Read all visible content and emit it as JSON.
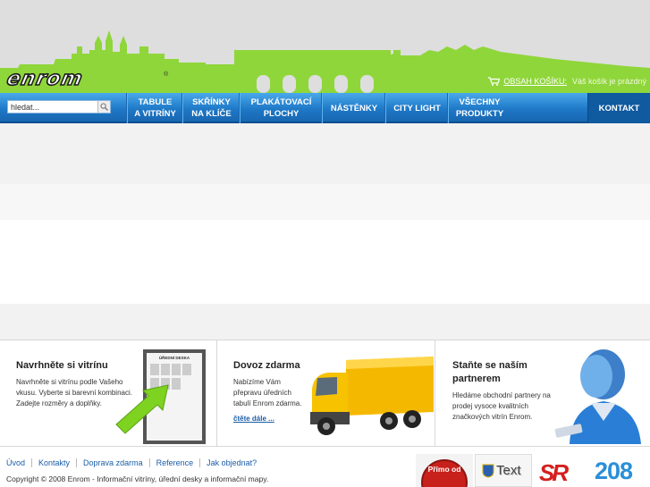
{
  "brand": {
    "logo_text": "enrom",
    "registered": "®"
  },
  "cart": {
    "link_label": "OBSAH KOŠÍKU:",
    "status": "Váš košík je prázdný"
  },
  "search": {
    "placeholder": "hledat..."
  },
  "nav": {
    "items": [
      {
        "line1": "TABULE",
        "line2": "A VITRÍNY"
      },
      {
        "line1": "SKŘÍNKY",
        "line2": "NA KLÍČE"
      },
      {
        "line1": "PLAKÁTOVACÍ",
        "line2": "PLOCHY"
      },
      {
        "line1": "NÁSTĚNKY",
        "line2": ""
      },
      {
        "line1": "CITY LIGHT",
        "line2": ""
      },
      {
        "line1": "VŠECHNY",
        "line2": "PRODUKTY"
      }
    ],
    "contact": "KONTAKT"
  },
  "features": [
    {
      "title": "Navrhněte si vitrínu",
      "text": "Navrhněte si vitrínu podle Vašeho vkusu. Vyberte si barevní kombinaci. Zadejte rozměry a doplňky.",
      "board_title": "ÚŘEDNÍ DESKA"
    },
    {
      "title": "Dovoz zdarma",
      "text": "Nabízíme Vám přepravu úředních tabulí Enrom zdarma.",
      "more": "čtěte dále ..."
    },
    {
      "title": "Staňte se naším partnerem",
      "text": "Hledáme obchodní partnery na prodej vysoce kvalitních značkových vitrín Enrom."
    }
  ],
  "footer": {
    "links": [
      "Úvod",
      "Kontakty",
      "Doprava zdarma",
      "Reference",
      "Jak objednat?"
    ],
    "copyright": "Copyright © 2008 Enrom - Informační vitríny, úřední desky a informační mapy."
  },
  "badges": {
    "primo": "Přímo od",
    "text_badge": "Text",
    "sr": "SR",
    "num": "208"
  },
  "colors": {
    "accent_green": "#8fd63a",
    "nav_blue": "#1f79c8",
    "link_blue": "#1a5da8",
    "header_grey": "#dedede"
  }
}
